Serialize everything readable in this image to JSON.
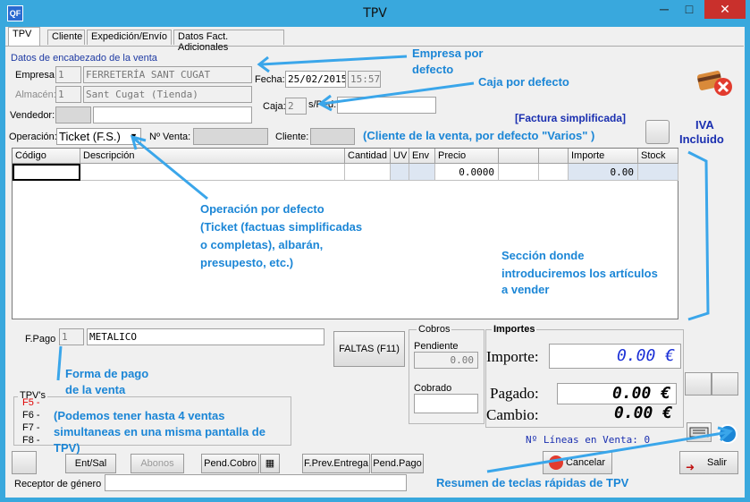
{
  "window": {
    "app_icon_text": "QF",
    "title": "TPV",
    "minimize": "─",
    "maximize": "□",
    "close": "✕"
  },
  "tabs": [
    "TPV",
    "Cliente",
    "Expedición/Envío",
    "Datos Fact. Adicionales"
  ],
  "header": {
    "section_title": "Datos de encabezado de la venta",
    "empresa_label": "Empresa:",
    "empresa_code": "1",
    "empresa_name": "FERRETERÍA SANT CUGAT",
    "almacen_label": "Almacén:",
    "almacen_code": "1",
    "almacen_name": "Sant Cugat (Tienda)",
    "vendedor_label": "Vendedor:",
    "fecha_label": "Fecha:",
    "fecha_value": "25/02/2015",
    "hora_value": "15:57",
    "caja_label": "Caja:",
    "caja_value": "2",
    "sped_label": "s/Ped:",
    "operacion_label": "Operación:",
    "operacion_value": "Ticket (F.S.)",
    "nventa_label": "Nº Venta:",
    "cliente_label": "Cliente:",
    "factura_simplificada": "[Factura simplificada]"
  },
  "grid": {
    "columns": [
      "Código",
      "Descripción",
      "Cantidad",
      "UV",
      "Env",
      "Precio",
      "",
      "",
      "Importe",
      "Stock"
    ],
    "row": {
      "precio": "0.0000",
      "importe": "0.00"
    }
  },
  "footer": {
    "fpago_label": "F.Pago",
    "fpago_code": "1",
    "fpago_value": "METALICO",
    "faltas_button": "FALTAS (F11)",
    "cobros_title": "Cobros",
    "pendiente_label": "Pendiente",
    "pendiente_value": "0.00",
    "cobrado_label": "Cobrado",
    "importes_title": "Importes",
    "importe_label": "Importe:",
    "importe_value": "0.00 €",
    "pagado_label": "Pagado:",
    "pagado_value": "0.00 €",
    "cambio_label": "Cambio:",
    "cambio_value": "0.00 €",
    "tpvs_title": "TPV's",
    "tpvs": [
      "F5 -",
      "F6 -",
      "F7 -",
      "F8 -"
    ],
    "lineas": "Nº Líneas en Venta: 0",
    "buttons": [
      "Ent/Sal",
      "Abonos",
      "Pend.Cobro",
      "F.Prev.Entrega",
      "Pend.Pago"
    ],
    "cancelar": "Cancelar",
    "salir": "Salir",
    "receptor_label": "Receptor de género"
  },
  "annotations": {
    "empresa": [
      "Empresa por",
      "defecto"
    ],
    "caja": "Caja por defecto",
    "iva": [
      "IVA",
      "Incluido"
    ],
    "cliente": "(Cliente de la venta, por defecto \"Varios\" )",
    "operacion": [
      "Operación por defecto",
      "(Ticket (factuas simplificadas",
      "o completas), albarán,",
      "presupesto, etc.)"
    ],
    "seccion": [
      "Sección donde",
      "introduciremos los artículos",
      "a vender"
    ],
    "forma_pago": [
      "Forma de pago",
      "de la venta"
    ],
    "tpvs": [
      "(Podemos tener hasta 4 ventas",
      "simultaneas en una misma pantalla de",
      "TPV)"
    ],
    "resumen": "Resumen de teclas rápidas de TPV"
  },
  "colors": {
    "titlebar": "#39a8dd",
    "annotation": "#1b86d6",
    "annotation_navy": "#1a2fb0",
    "total_blue": "#1a2fd6",
    "tpv_red": "#e00000"
  }
}
